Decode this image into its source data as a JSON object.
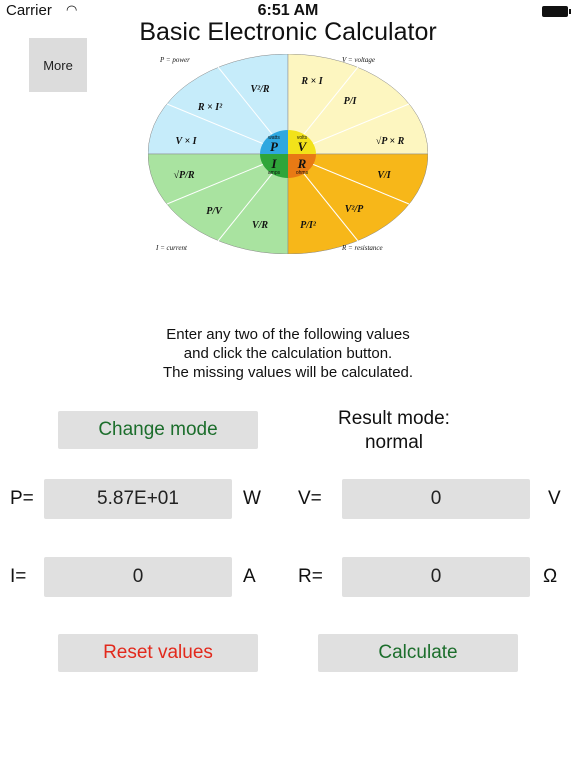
{
  "status_bar": {
    "carrier": "Carrier",
    "time": "6:51 AM"
  },
  "header": {
    "title": "Basic Electronic Calculator",
    "more_label": "More"
  },
  "wheel": {
    "labels": {
      "power": "P = power",
      "voltage": "V = voltage",
      "current": "I = current",
      "resistance": "R = resistance"
    },
    "center": {
      "p": "P",
      "p_unit": "watts",
      "v": "V",
      "v_unit": "volts",
      "i": "I",
      "i_unit": "amps",
      "r": "R",
      "r_unit": "ohms"
    },
    "formulas": {
      "p1": "V²/R",
      "p2": "R × I²",
      "p3": "V × I",
      "v1": "R × I",
      "v2": "P/I",
      "v3": "√P × R",
      "i1": "√P/R",
      "i2": "P/V",
      "i3": "V/R",
      "r1": "P/I²",
      "r2": "V²/P",
      "r3": "V/I"
    },
    "colors": {
      "power": "#c6ecfa",
      "voltage": "#fdf6c0",
      "current": "#a9e3a0",
      "resistance": "#f7b719"
    }
  },
  "instructions": [
    "Enter any two of the following values",
    "and click the calculation button.",
    "The missing values will be calculated."
  ],
  "controls": {
    "change_mode": "Change mode",
    "result_mode_label": "Result mode:",
    "result_mode_value": "normal",
    "reset": "Reset values",
    "calculate": "Calculate"
  },
  "fields": {
    "p": {
      "label": "P=",
      "value": "5.87E+01",
      "unit": "W"
    },
    "v": {
      "label": "V=",
      "value": "0",
      "unit": "V"
    },
    "i": {
      "label": "I=",
      "value": "0",
      "unit": "A"
    },
    "r": {
      "label": "R=",
      "value": "0",
      "unit": "Ω"
    }
  }
}
